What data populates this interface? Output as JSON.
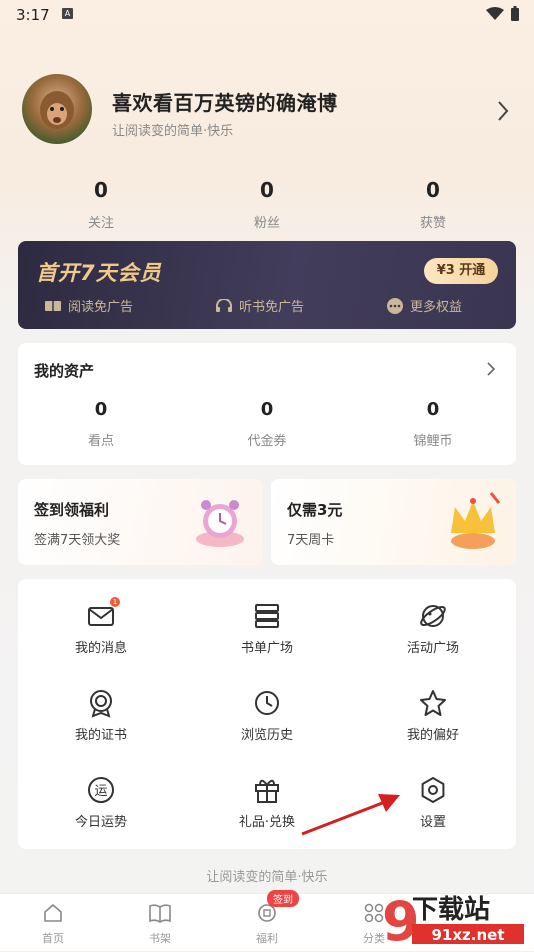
{
  "status_bar": {
    "time": "3:17",
    "notification_icon": "A"
  },
  "profile": {
    "username": "喜欢看百万英镑的确淹博",
    "motto": "让阅读变的简单·快乐",
    "stats": [
      {
        "value": "0",
        "label": "关注"
      },
      {
        "value": "0",
        "label": "粉丝"
      },
      {
        "value": "0",
        "label": "获赞"
      }
    ]
  },
  "vip": {
    "title": "首开7天会员",
    "button": "¥3 开通",
    "features": [
      "阅读免广告",
      "听书免广告",
      "更多权益"
    ]
  },
  "assets": {
    "title": "我的资产",
    "items": [
      {
        "value": "0",
        "label": "看点"
      },
      {
        "value": "0",
        "label": "代金券"
      },
      {
        "value": "0",
        "label": "锦鲤币"
      }
    ]
  },
  "promos": {
    "left": {
      "title": "签到领福利",
      "subtitle": "签满7天领大奖"
    },
    "right": {
      "title": "仅需3元",
      "subtitle": "7天周卡"
    }
  },
  "menu": {
    "message_badge": "1",
    "items": [
      {
        "label": "我的消息",
        "icon": "mail-icon"
      },
      {
        "label": "书单广场",
        "icon": "stack-icon"
      },
      {
        "label": "活动广场",
        "icon": "planet-icon"
      },
      {
        "label": "我的证书",
        "icon": "badge-icon"
      },
      {
        "label": "浏览历史",
        "icon": "clock-icon"
      },
      {
        "label": "我的偏好",
        "icon": "star-icon"
      },
      {
        "label": "今日运势",
        "icon": "fortune-icon"
      },
      {
        "label": "礼品·兑换",
        "icon": "gift-icon"
      },
      {
        "label": "设置",
        "icon": "settings-icon"
      }
    ]
  },
  "footer_motto": "让阅读变的简单·快乐",
  "tabbar": {
    "badge": "签到",
    "tabs": [
      {
        "label": "首页"
      },
      {
        "label": "书架"
      },
      {
        "label": "福利"
      },
      {
        "label": "分类"
      }
    ]
  },
  "watermark": {
    "title": "下载站",
    "url": "91xz.net"
  },
  "colors": {
    "accent": "#f04444",
    "vip_gold": "#f1c98c",
    "vip_bg": "#2d2a40"
  }
}
